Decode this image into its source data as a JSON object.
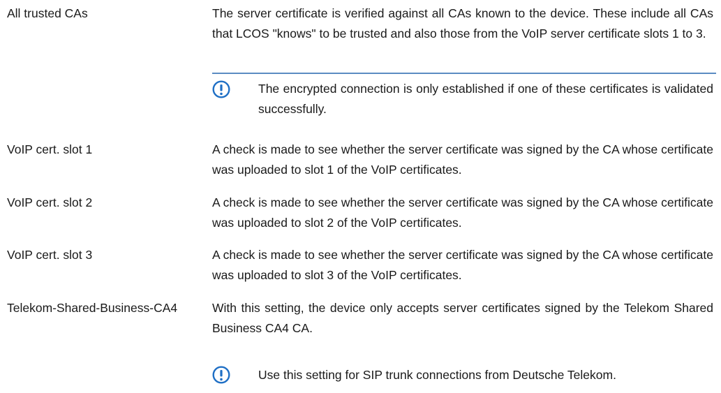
{
  "rows": [
    {
      "term": "All trusted CAs",
      "description": "The server certificate is verified against all CAs known to the device. These include all CAs that LCOS \"knows\" to be trusted and also those from the VoIP server certificate slots 1 to 3.",
      "note": "The encrypted connection is only established if one of these certificates is validated successfully."
    },
    {
      "term": "VoIP cert. slot 1",
      "description": "A check is made to see whether the server certificate was signed by the CA whose certificate was uploaded to slot 1 of the VoIP certificates."
    },
    {
      "term": "VoIP cert. slot 2",
      "description": "A check is made to see whether the server certificate was signed by the CA whose certificate was uploaded to slot 2 of the VoIP certificates."
    },
    {
      "term": "VoIP cert. slot 3",
      "description": "A check is made to see whether the server certificate was signed by the CA whose certificate was uploaded to slot 3 of the VoIP certificates."
    },
    {
      "term": "Telekom-Shared-Business-CA4",
      "description": "With this setting, the device only accepts server certificates signed by the Telekom Shared Business CA4 CA.",
      "note": "Use this setting for SIP trunk connections from Deutsche Telekom."
    }
  ],
  "note_icon": "exclamation-circle-icon",
  "colors": {
    "accent": "#1f6fc5",
    "rule": "#5b8bc2",
    "text": "#1a1a1a"
  }
}
